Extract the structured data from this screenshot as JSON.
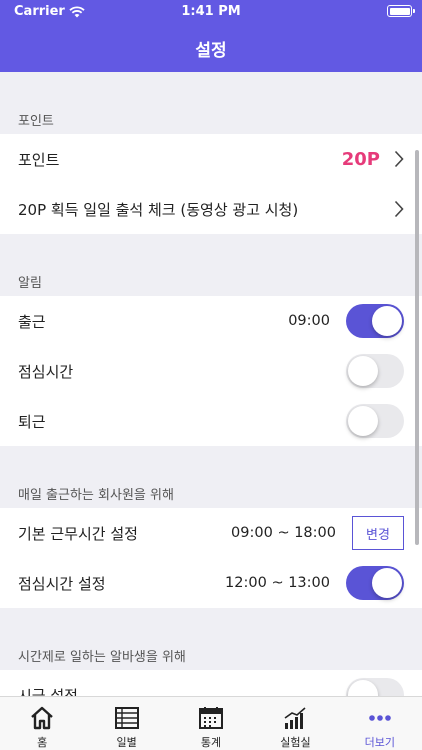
{
  "status_bar": {
    "carrier": "Carrier",
    "time": "1:41 PM"
  },
  "header": {
    "title": "설정"
  },
  "sections": {
    "points": {
      "title": "포인트",
      "rows": [
        {
          "label": "포인트",
          "value": "20P"
        },
        {
          "label": "20P 획득 일일 출석 체크 (동영상 광고 시청)"
        }
      ]
    },
    "alarm": {
      "title": "알림",
      "rows": [
        {
          "label": "출근",
          "value": "09:00",
          "toggle": true
        },
        {
          "label": "점심시간",
          "toggle": false
        },
        {
          "label": "퇴근",
          "toggle": false
        }
      ]
    },
    "employee": {
      "title": "매일 출근하는 회사원을 위해",
      "rows": [
        {
          "label": "기본 근무시간 설정",
          "value": "09:00 ~ 18:00",
          "button": "변경"
        },
        {
          "label": "점심시간 설정",
          "value": "12:00 ~ 13:00",
          "toggle": true
        }
      ]
    },
    "parttime": {
      "title": "시간제로 일하는 알바생을 위해",
      "rows": [
        {
          "label": "시급 설정",
          "toggle": false
        }
      ]
    }
  },
  "tabs": [
    {
      "label": "홈",
      "icon": "home-icon"
    },
    {
      "label": "일별",
      "icon": "list-icon"
    },
    {
      "label": "통계",
      "icon": "calendar-icon"
    },
    {
      "label": "실험실",
      "icon": "chart-icon"
    },
    {
      "label": "더보기",
      "icon": "more-icon",
      "active": true
    }
  ],
  "colors": {
    "accent": "#5a54d6",
    "header": "#6259e3",
    "points": "#e63b7a"
  }
}
